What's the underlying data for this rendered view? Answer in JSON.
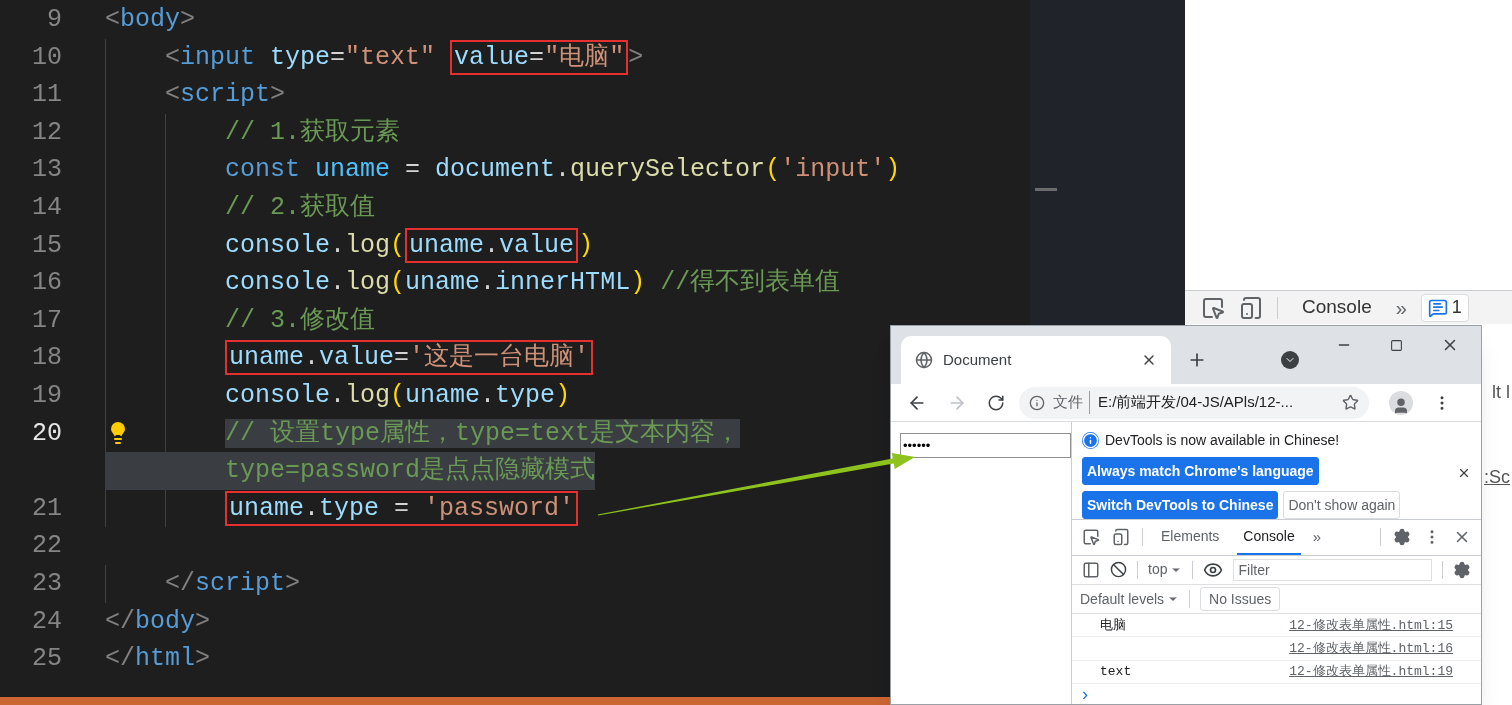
{
  "editor": {
    "lines": [
      {
        "number": "9",
        "selected": false,
        "lightbulb": false,
        "tokens": [
          {
            "text": "<",
            "kind": "punct"
          },
          {
            "text": "body",
            "kind": "tag"
          },
          {
            "text": ">",
            "kind": "punct"
          }
        ]
      },
      {
        "number": "10",
        "selected": false,
        "lightbulb": false,
        "tokens": [
          {
            "text": "    <",
            "kind": "punct"
          },
          {
            "text": "input",
            "kind": "tag"
          },
          {
            "text": " type",
            "kind": "attr"
          },
          {
            "text": "=",
            "kind": "plain"
          },
          {
            "text": "\"text\" ",
            "kind": "string"
          },
          {
            "kind": "frame",
            "tokens": [
              {
                "text": "value",
                "kind": "attr"
              },
              {
                "text": "=",
                "kind": "plain"
              },
              {
                "text": "\"电脑\"",
                "kind": "string"
              }
            ]
          },
          {
            "text": ">",
            "kind": "punct"
          }
        ]
      },
      {
        "number": "11",
        "selected": false,
        "lightbulb": false,
        "tokens": [
          {
            "text": "    <",
            "kind": "punct"
          },
          {
            "text": "script",
            "kind": "tag"
          },
          {
            "text": ">",
            "kind": "punct"
          }
        ]
      },
      {
        "number": "12",
        "selected": false,
        "lightbulb": false,
        "tokens": [
          {
            "text": "        // 1.获取元素",
            "kind": "comment"
          }
        ]
      },
      {
        "number": "13",
        "selected": false,
        "lightbulb": false,
        "tokens": [
          {
            "text": "        const ",
            "kind": "keyword"
          },
          {
            "text": "uname",
            "kind": "constant"
          },
          {
            "text": " = ",
            "kind": "plain"
          },
          {
            "text": "document",
            "kind": "variable"
          },
          {
            "text": ".",
            "kind": "plain"
          },
          {
            "text": "querySelector",
            "kind": "function"
          },
          {
            "text": "(",
            "kind": "bracket"
          },
          {
            "text": "'input'",
            "kind": "string"
          },
          {
            "text": ")",
            "kind": "bracket"
          }
        ]
      },
      {
        "number": "14",
        "selected": false,
        "lightbulb": false,
        "tokens": [
          {
            "text": "        // 2.获取值",
            "kind": "comment"
          }
        ]
      },
      {
        "number": "15",
        "selected": false,
        "lightbulb": false,
        "tokens": [
          {
            "text": "        console",
            "kind": "variable"
          },
          {
            "text": ".",
            "kind": "plain"
          },
          {
            "text": "log",
            "kind": "function"
          },
          {
            "text": "(",
            "kind": "bracket"
          },
          {
            "kind": "frame",
            "tokens": [
              {
                "text": "uname",
                "kind": "variable"
              },
              {
                "text": ".",
                "kind": "plain"
              },
              {
                "text": "value",
                "kind": "variable"
              }
            ]
          },
          {
            "text": ")",
            "kind": "bracket"
          }
        ]
      },
      {
        "number": "16",
        "selected": false,
        "lightbulb": false,
        "tokens": [
          {
            "text": "        console",
            "kind": "variable"
          },
          {
            "text": ".",
            "kind": "plain"
          },
          {
            "text": "log",
            "kind": "function"
          },
          {
            "text": "(",
            "kind": "bracket"
          },
          {
            "text": "uname",
            "kind": "variable"
          },
          {
            "text": ".",
            "kind": "plain"
          },
          {
            "text": "innerHTML",
            "kind": "variable"
          },
          {
            "text": ")",
            "kind": "bracket"
          },
          {
            "text": " //得不到表单值",
            "kind": "comment"
          }
        ]
      },
      {
        "number": "17",
        "selected": false,
        "lightbulb": false,
        "tokens": [
          {
            "text": "        // 3.修改值",
            "kind": "comment"
          }
        ]
      },
      {
        "number": "18",
        "selected": false,
        "lightbulb": false,
        "tokens": [
          {
            "kind": "frame",
            "tokens": [
              {
                "text": "        uname",
                "kind": "variable"
              },
              {
                "text": ".",
                "kind": "plain"
              },
              {
                "text": "value",
                "kind": "variable"
              },
              {
                "text": "=",
                "kind": "plain"
              },
              {
                "text": "'这是一台电脑'",
                "kind": "string"
              }
            ]
          }
        ]
      },
      {
        "number": "19",
        "selected": false,
        "lightbulb": false,
        "tokens": [
          {
            "text": "        console",
            "kind": "variable"
          },
          {
            "text": ".",
            "kind": "plain"
          },
          {
            "text": "log",
            "kind": "function"
          },
          {
            "text": "(",
            "kind": "bracket"
          },
          {
            "text": "uname",
            "kind": "variable"
          },
          {
            "text": ".",
            "kind": "plain"
          },
          {
            "text": "type",
            "kind": "variable"
          },
          {
            "text": ")",
            "kind": "bracket"
          }
        ]
      },
      {
        "number": "20",
        "selected": true,
        "lightbulb": true,
        "tokens": [
          {
            "text": "        // 设置type属性，type=text是文本内容，",
            "kind": "comment"
          }
        ],
        "wrapped": "type=password是点点隐藏模式"
      },
      {
        "number": "21",
        "selected": false,
        "lightbulb": false,
        "tokens": [
          {
            "kind": "frame",
            "tokens": [
              {
                "text": "        uname",
                "kind": "variable"
              },
              {
                "text": ".",
                "kind": "plain"
              },
              {
                "text": "type",
                "kind": "variable"
              },
              {
                "text": " = ",
                "kind": "plain"
              },
              {
                "text": "'password'",
                "kind": "string"
              }
            ]
          }
        ]
      },
      {
        "number": "22",
        "selected": false,
        "lightbulb": false
      },
      {
        "number": "23",
        "selected": false,
        "lightbulb": false,
        "tokens": [
          {
            "text": "    </",
            "kind": "punct"
          },
          {
            "text": "script",
            "kind": "tag"
          },
          {
            "text": ">",
            "kind": "punct"
          }
        ]
      },
      {
        "number": "24",
        "selected": false,
        "lightbulb": false,
        "tokens": [
          {
            "text": "</",
            "kind": "punct"
          },
          {
            "text": "body",
            "kind": "tag"
          },
          {
            "text": ">",
            "kind": "punct"
          }
        ]
      },
      {
        "number": "25",
        "selected": false,
        "lightbulb": false,
        "tokens": [
          {
            "text": "</",
            "kind": "punct"
          },
          {
            "text": "html",
            "kind": "tag"
          },
          {
            "text": ">",
            "kind": "punct"
          }
        ]
      }
    ]
  },
  "background_window": {
    "devtools_tab": "Console",
    "more": "»",
    "issues_badge": "1",
    "peek_texts": [
      "lt l",
      ":Sc"
    ]
  },
  "browser": {
    "tab_title": "Document",
    "omnibox": {
      "scheme": "文件",
      "url": "E:/前端开发/04-JS/APls/12-..."
    },
    "page": {
      "input_value": "••••••"
    },
    "devtools": {
      "notice": {
        "message": "DevTools is now available in Chinese!",
        "buttons": [
          {
            "label": "Always match Chrome's language",
            "kind": "primary"
          },
          {
            "label": "Switch DevTools to Chinese",
            "kind": "primary"
          },
          {
            "label": "Don't show again",
            "kind": "secondary"
          }
        ]
      },
      "tabs": [
        {
          "label": "Elements",
          "selected": false
        },
        {
          "label": "Console",
          "selected": true
        }
      ],
      "more": "»",
      "context": "top",
      "filter_placeholder": "Filter",
      "levels": "Default levels",
      "issues": "No Issues",
      "messages": [
        {
          "text": "电脑",
          "source": "12-修改表单属性.html:15"
        },
        {
          "source": "12-修改表单属性.html:16"
        },
        {
          "text": "text",
          "source": "12-修改表单属性.html:19"
        }
      ],
      "prompt": "›"
    }
  }
}
